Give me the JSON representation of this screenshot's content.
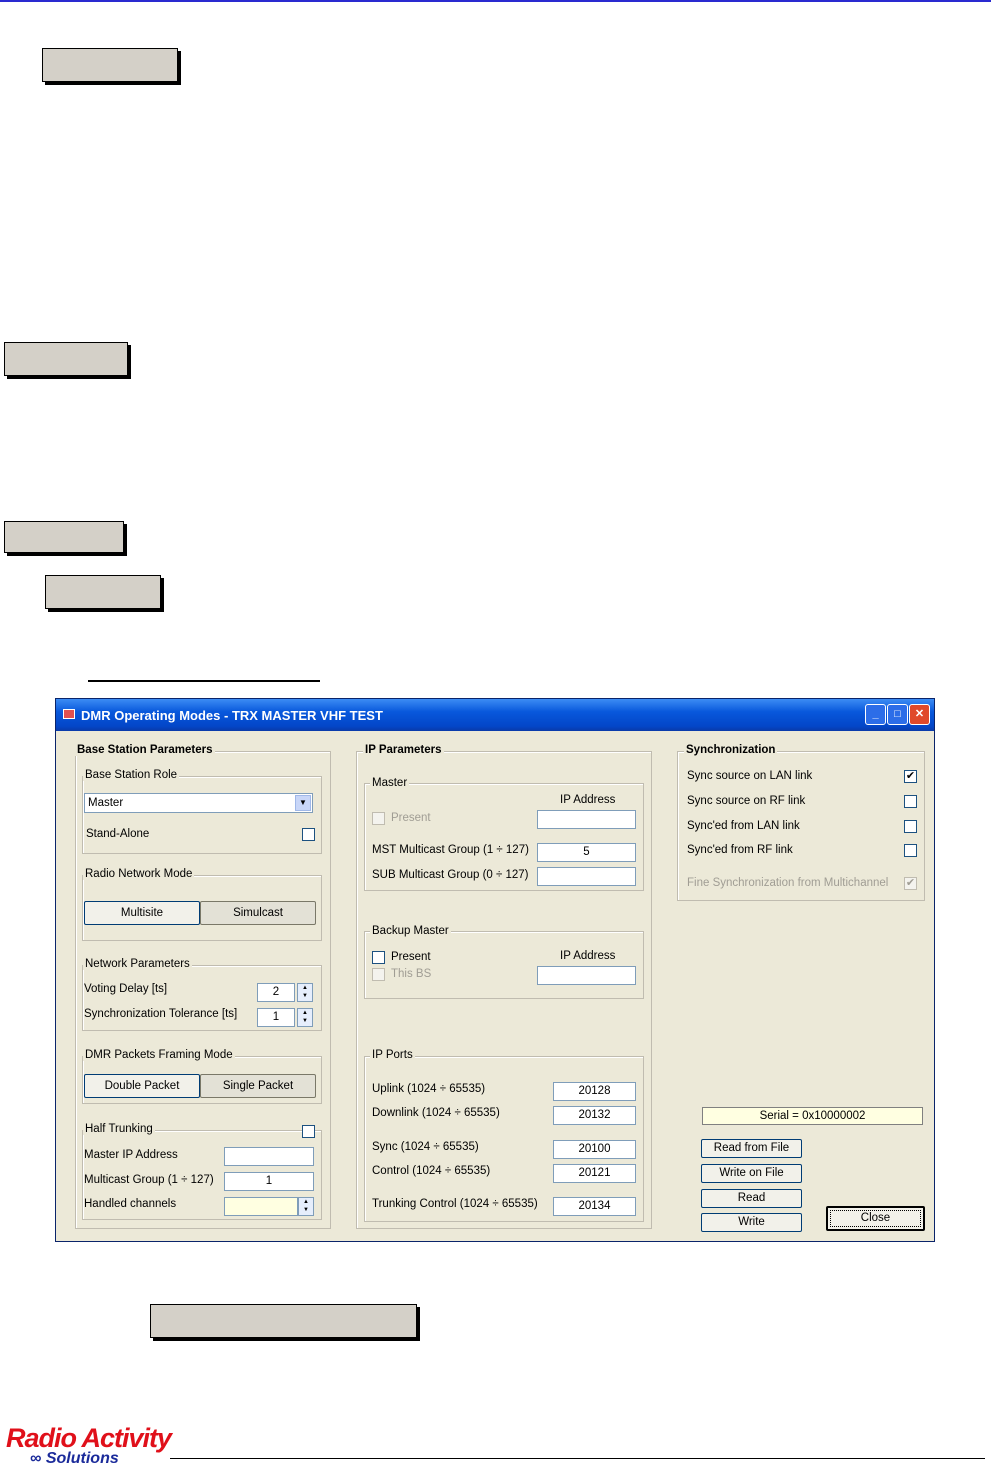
{
  "window": {
    "title": "DMR Operating Modes - TRX MASTER VHF TEST",
    "minimize_glyph": "_",
    "maximize_glyph": "□",
    "close_glyph": "✕"
  },
  "base_station": {
    "title": "Base Station Parameters",
    "role_group": "Base Station Role",
    "role_value": "Master",
    "stand_alone_label": "Stand-Alone",
    "radio_mode_group": "Radio Network Mode",
    "multisite_label": "Multisite",
    "simulcast_label": "Simulcast",
    "network_group": "Network Parameters",
    "voting_delay_label": "Voting Delay [ts]",
    "voting_delay_value": "2",
    "sync_tolerance_label": "Synchronization Tolerance [ts]",
    "sync_tolerance_value": "1",
    "framing_group": "DMR Packets Framing Mode",
    "double_packet_label": "Double Packet",
    "single_packet_label": "Single Packet",
    "half_trunking_group": "Half Trunking",
    "master_ip_label": "Master IP Address",
    "master_ip_value": "",
    "multicast_group_label": "Multicast Group (1 ÷ 127)",
    "multicast_group_value": "1",
    "handled_channels_label": "Handled channels",
    "handled_channels_value": ""
  },
  "ip_params": {
    "title": "IP Parameters",
    "master_group": "Master",
    "ip_address_header": "IP Address",
    "present_label": "Present",
    "master_ip_value": "",
    "mst_multicast_label": "MST Multicast Group (1 ÷ 127)",
    "mst_multicast_value": "5",
    "sub_multicast_label": "SUB Multicast Group (0 ÷ 127)",
    "sub_multicast_value": "",
    "backup_group": "Backup Master",
    "backup_ip_header": "IP Address",
    "backup_present_label": "Present",
    "this_bs_label": "This BS",
    "backup_ip_value": "",
    "ports_group": "IP Ports",
    "uplink_label": "Uplink (1024 ÷ 65535)",
    "uplink_value": "20128",
    "downlink_label": "Downlink (1024 ÷ 65535)",
    "downlink_value": "20132",
    "sync_label": "Sync (1024 ÷ 65535)",
    "sync_value": "20100",
    "control_label": "Control (1024 ÷ 65535)",
    "control_value": "20121",
    "trunking_label": "Trunking Control (1024 ÷ 65535)",
    "trunking_value": "20134"
  },
  "sync": {
    "title": "Synchronization",
    "lan_source_label": "Sync source on LAN link",
    "rf_source_label": "Sync source on RF link",
    "from_lan_label": "Sync'ed from LAN link",
    "from_rf_label": "Sync'ed from RF link",
    "fine_sync_label": "Fine Synchronization from Multichannel",
    "check_glyph": "✔"
  },
  "actions": {
    "serial": "Serial = 0x10000002",
    "read_from_file": "Read from File",
    "write_on_file": "Write on File",
    "read": "Read",
    "write": "Write",
    "close": "Close"
  },
  "footer": {
    "logo_line1": "Radio Activity",
    "logo_line2": "∞ Solutions"
  },
  "colors": {
    "titlebar": "#0858dc",
    "logo_red": "#e0101a",
    "logo_blue": "#1a2a9a"
  }
}
